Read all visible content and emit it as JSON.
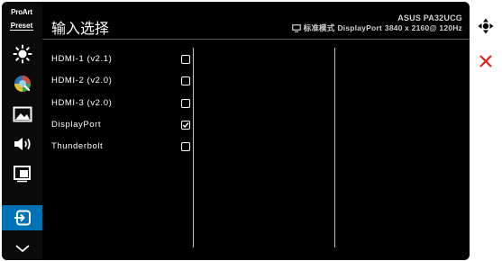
{
  "brand": {
    "line1": "ProArt",
    "line2": "Preset"
  },
  "header": {
    "title": "输入选择",
    "model": "ASUS PA32UCG",
    "mode_label": "标准模式",
    "input": "DisplayPort",
    "resolution": "3840 x 2160@ 120Hz"
  },
  "sidebar": {
    "icons": [
      "proart-preset-icon",
      "brightness-icon",
      "color-icon",
      "image-icon",
      "sound-icon",
      "pip-pbp-icon",
      "input-select-icon",
      "chevron-down-icon"
    ],
    "active": "input-select-icon"
  },
  "inputs": [
    {
      "label": "HDMI-1 (v2.1)",
      "checked": false
    },
    {
      "label": "HDMI-2 (v2.0)",
      "checked": false
    },
    {
      "label": "HDMI-3 (v2.0)",
      "checked": false
    },
    {
      "label": "DisplayPort",
      "checked": true
    },
    {
      "label": "Thunderbolt",
      "checked": false
    }
  ],
  "nav": [
    "joystick-move-icon",
    "exit-icon"
  ],
  "colors": {
    "accent": "#0073b7",
    "exit": "#e0201b",
    "background": "#000000"
  }
}
